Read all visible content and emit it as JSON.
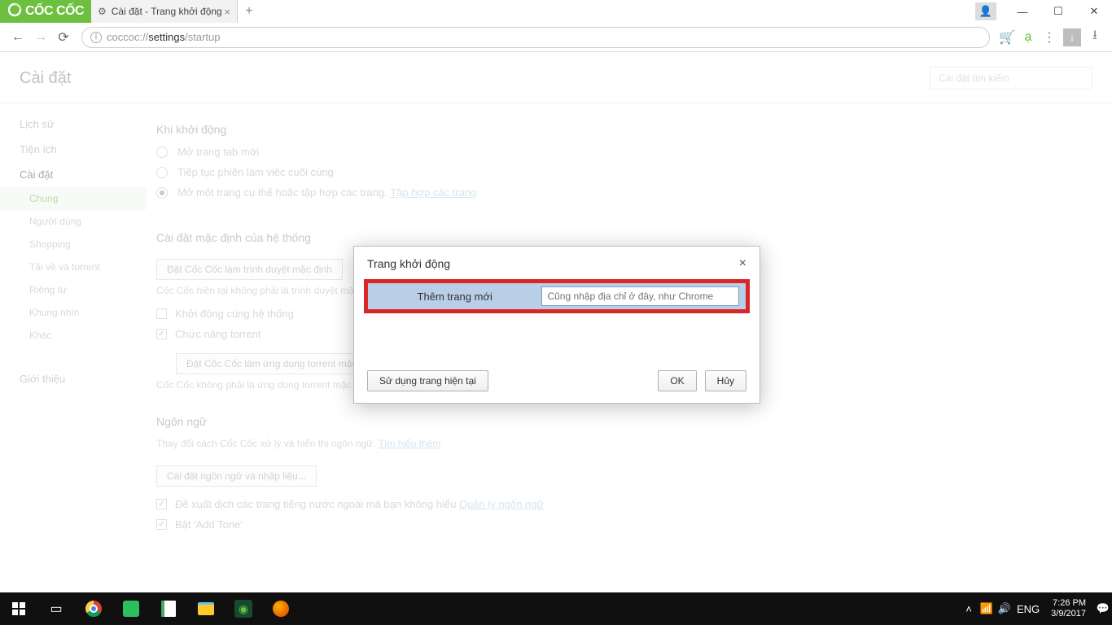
{
  "browser": {
    "logo_text": "CỐC CỐC",
    "tab_title": "Cài đặt - Trang khởi động",
    "url_scheme": "coccoc://",
    "url_gray": "settings",
    "url_path": "/startup"
  },
  "page": {
    "title": "Cài đặt",
    "search_placeholder": "Cài đặt tìm kiếm"
  },
  "sidebar": {
    "items": [
      "Lịch sử",
      "Tiện ích",
      "Cài đặt"
    ],
    "subs": [
      "Chung",
      "Người dùng",
      "Shopping",
      "Tải về và torrent",
      "Riêng tư",
      "Khung nhìn",
      "Khác"
    ],
    "about": "Giới thiệu"
  },
  "startup": {
    "heading": "Khi khởi động",
    "opt_newtab": "Mở trang tab mới",
    "opt_continue": "Tiếp tục phiên làm việc cuối cùng",
    "opt_specific": "Mở một trang cụ thể hoặc tập hợp các trang.",
    "opt_specific_link": "Tập hợp các trang"
  },
  "system": {
    "heading": "Cài đặt mặc định của hệ thống",
    "btn_default": "Đặt Cốc Cốc làm trình duyệt mặc định",
    "note_default": "Cốc Cốc hiện tại không phải là trình duyệt mặc định",
    "chk_startup": "Khởi động cùng hệ thống",
    "chk_torrent": "Chức năng torrent",
    "btn_torrent": "Đặt Cốc Cốc làm ứng dụng torrent mặc định",
    "note_torrent": "Cốc Cốc không phải là ứng dụng torrent mặc định."
  },
  "lang": {
    "heading": "Ngôn ngữ",
    "desc": "Thay đổi cách Cốc Cốc xử lý và hiển thị ngôn ngữ.",
    "desc_link": "Tìm hiểu thêm",
    "btn_lang": "Cài đặt ngôn ngữ và nhập liệu...",
    "chk_translate": "Đề xuất dịch các trang tiếng nước ngoài mà bạn không hiểu",
    "chk_translate_link": "Quản lý ngôn ngữ",
    "chk_addtone": "Bật 'Add Tone'"
  },
  "modal": {
    "title": "Trang khởi động",
    "row_label": "Thêm trang mới",
    "row_placeholder": "Cũng nhập địa chỉ ở đây, như Chrome",
    "btn_current": "Sử dụng trang hiện tại",
    "btn_ok": "OK",
    "btn_cancel": "Hủy"
  },
  "taskbar": {
    "lang": "ENG",
    "time": "7:26 PM",
    "date": "3/9/2017"
  }
}
